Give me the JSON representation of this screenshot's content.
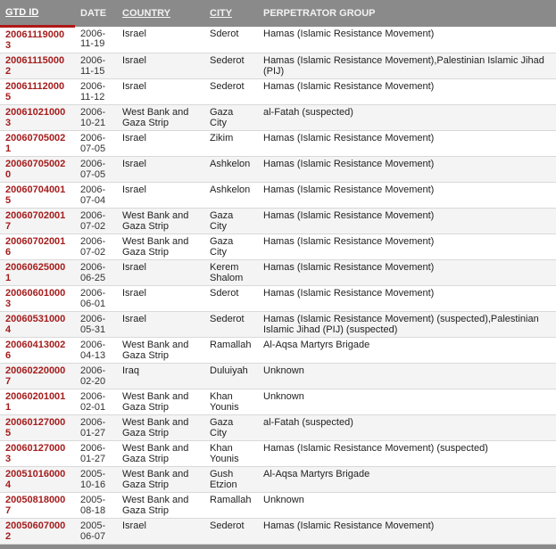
{
  "headers": {
    "id": "GTD ID",
    "date": "DATE",
    "country": "COUNTRY",
    "city": "CITY",
    "perp": "PERPETRATOR GROUP"
  },
  "rows": [
    {
      "id": "200611190003",
      "date": "2006-11-19",
      "country": "Israel",
      "city": "Sderot",
      "perp": "Hamas (Islamic Resistance Movement)"
    },
    {
      "id": "200611150002",
      "date": "2006-11-15",
      "country": "Israel",
      "city": "Sederot",
      "perp": "Hamas (Islamic Resistance Movement),Palestinian Islamic Jihad (PIJ)"
    },
    {
      "id": "200611120005",
      "date": "2006-11-12",
      "country": "Israel",
      "city": "Sederot",
      "perp": "Hamas (Islamic Resistance Movement)"
    },
    {
      "id": "200610210003",
      "date": "2006-10-21",
      "country": "West Bank and Gaza Strip",
      "city": "Gaza City",
      "perp": "al-Fatah (suspected)"
    },
    {
      "id": "200607050021",
      "date": "2006-07-05",
      "country": "Israel",
      "city": "Zikim",
      "perp": "Hamas (Islamic Resistance Movement)"
    },
    {
      "id": "200607050020",
      "date": "2006-07-05",
      "country": "Israel",
      "city": "Ashkelon",
      "perp": "Hamas (Islamic Resistance Movement)"
    },
    {
      "id": "200607040015",
      "date": "2006-07-04",
      "country": "Israel",
      "city": "Ashkelon",
      "perp": "Hamas (Islamic Resistance Movement)"
    },
    {
      "id": "200607020017",
      "date": "2006-07-02",
      "country": "West Bank and Gaza Strip",
      "city": "Gaza City",
      "perp": "Hamas (Islamic Resistance Movement)"
    },
    {
      "id": "200607020016",
      "date": "2006-07-02",
      "country": "West Bank and Gaza Strip",
      "city": "Gaza City",
      "perp": "Hamas (Islamic Resistance Movement)"
    },
    {
      "id": "200606250001",
      "date": "2006-06-25",
      "country": "Israel",
      "city": "Kerem Shalom",
      "perp": "Hamas (Islamic Resistance Movement)"
    },
    {
      "id": "200606010003",
      "date": "2006-06-01",
      "country": "Israel",
      "city": "Sderot",
      "perp": "Hamas (Islamic Resistance Movement)"
    },
    {
      "id": "200605310004",
      "date": "2006-05-31",
      "country": "Israel",
      "city": "Sederot",
      "perp": "Hamas (Islamic Resistance Movement) (suspected),Palestinian Islamic Jihad (PIJ) (suspected)"
    },
    {
      "id": "200604130026",
      "date": "2006-04-13",
      "country": "West Bank and Gaza Strip",
      "city": "Ramallah",
      "perp": "Al-Aqsa Martyrs Brigade"
    },
    {
      "id": "200602200007",
      "date": "2006-02-20",
      "country": "Iraq",
      "city": "Duluiyah",
      "perp": "Unknown"
    },
    {
      "id": "200602010011",
      "date": "2006-02-01",
      "country": "West Bank and Gaza Strip",
      "city": "Khan Younis",
      "perp": "Unknown"
    },
    {
      "id": "200601270005",
      "date": "2006-01-27",
      "country": "West Bank and Gaza Strip",
      "city": "Gaza City",
      "perp": "al-Fatah (suspected)"
    },
    {
      "id": "200601270003",
      "date": "2006-01-27",
      "country": "West Bank and Gaza Strip",
      "city": "Khan Younis",
      "perp": "Hamas (Islamic Resistance Movement) (suspected)"
    },
    {
      "id": "200510160004",
      "date": "2005-10-16",
      "country": "West Bank and Gaza Strip",
      "city": "Gush Etzion",
      "perp": "Al-Aqsa Martyrs Brigade"
    },
    {
      "id": "200508180007",
      "date": "2005-08-18",
      "country": "West Bank and Gaza Strip",
      "city": "Ramallah",
      "perp": "Unknown"
    },
    {
      "id": "200506070002",
      "date": "2005-06-07",
      "country": "Israel",
      "city": "Sederot",
      "perp": "Hamas (Islamic Resistance Movement)"
    }
  ]
}
